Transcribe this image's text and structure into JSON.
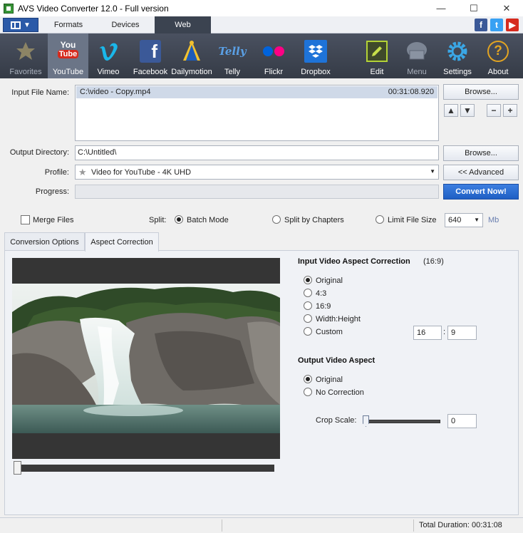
{
  "window": {
    "title": "AVS Video Converter 12.0 - Full version",
    "minimize": "—",
    "maximize": "☐",
    "close": "✕"
  },
  "tabs": {
    "formats": "Formats",
    "devices": "Devices",
    "web": "Web",
    "active": "Web"
  },
  "social": {
    "facebook": "f",
    "twitter": "t",
    "youtube": "▶"
  },
  "toolbar": {
    "favorites": "Favorites",
    "youtube": "YouTube",
    "vimeo": "Vimeo",
    "facebook": "Facebook",
    "dailymotion": "Dailymotion",
    "telly": "Telly",
    "flickr": "Flickr",
    "dropbox": "Dropbox",
    "edit": "Edit",
    "menu": "Menu",
    "settings": "Settings",
    "about": "About",
    "youtube_icon_you": "You",
    "youtube_icon_tube": "Tube",
    "telly_icon": "Telly"
  },
  "input": {
    "label": "Input File Name:",
    "file": "C:\\video - Copy.mp4",
    "duration": "00:31:08.920",
    "browse": "Browse..."
  },
  "output": {
    "label": "Output Directory:",
    "value": "C:\\Untitled\\",
    "browse": "Browse..."
  },
  "profile": {
    "label": "Profile:",
    "value": "Video for YouTube - 4K UHD",
    "advanced": "<< Advanced"
  },
  "progress": {
    "label": "Progress:",
    "convert": "Convert Now!"
  },
  "options": {
    "merge_files": "Merge Files",
    "split_label": "Split:",
    "batch_mode": "Batch Mode",
    "split_by_chapters": "Split by Chapters",
    "limit_file_size": "Limit File Size",
    "file_size_value": "640",
    "file_size_unit": "Mb"
  },
  "panel_tabs": {
    "conversion_options": "Conversion Options",
    "aspect_correction": "Aspect Correction",
    "active": "Aspect Correction"
  },
  "aspect": {
    "input_title": "Input Video Aspect Correction",
    "input_ratio": "(16:9)",
    "input_options": [
      "Original",
      "4:3",
      "16:9",
      "Width:Height",
      "Custom"
    ],
    "input_selected": "Original",
    "custom_w": "16",
    "custom_sep": ":",
    "custom_h": "9",
    "output_title": "Output Video Aspect",
    "output_options": [
      "Original",
      "No Correction"
    ],
    "output_selected": "Original",
    "crop_label": "Crop Scale:",
    "crop_value": "0"
  },
  "status": {
    "total_duration": "Total Duration: 00:31:08"
  }
}
